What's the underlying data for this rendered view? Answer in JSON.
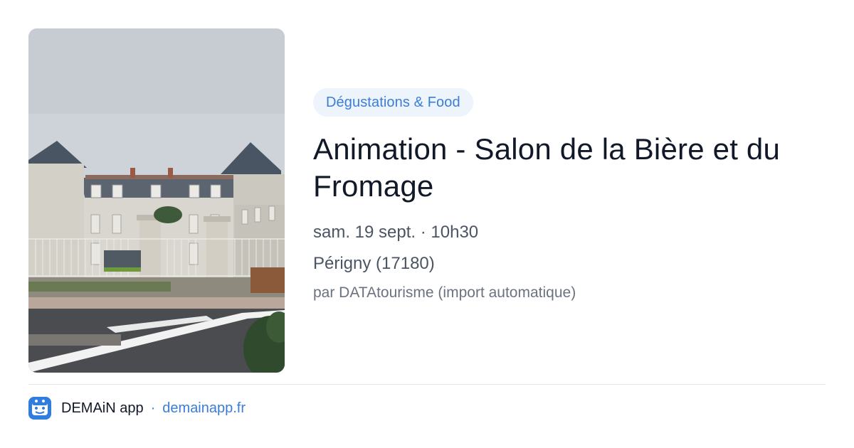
{
  "event": {
    "category": "Dégustations & Food",
    "title": "Animation - Salon de la Bière et du Fromage",
    "when": "sam. 19 sept. · 10h30",
    "where": "Périgny (17180)",
    "source": "par DATAtourisme (import automatique)"
  },
  "footer": {
    "app_name": "DEMAiN app",
    "separator": "·",
    "domain": "demainapp.fr"
  },
  "colors": {
    "accent": "#3b7dd8",
    "badge_bg": "#eef4fb",
    "title": "#111827",
    "meta": "#4b5563"
  },
  "icons": {
    "app_logo": "demain-app-logo-icon"
  }
}
